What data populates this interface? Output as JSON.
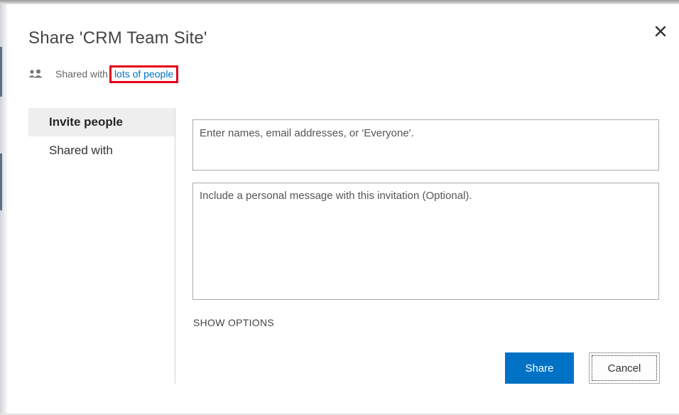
{
  "dialog": {
    "title": "Share 'CRM Team Site'",
    "close_icon": "close-icon",
    "shared_with_prefix": "Shared with",
    "shared_with_link": "lots of people",
    "people_icon": "people-icon"
  },
  "nav": {
    "items": [
      {
        "label": "Invite people",
        "selected": true
      },
      {
        "label": "Shared with",
        "selected": false
      }
    ]
  },
  "invite": {
    "names_placeholder": "Enter names, email addresses, or 'Everyone'.",
    "names_value": "",
    "message_placeholder": "Include a personal message with this invitation (Optional).",
    "message_value": "",
    "show_options_label": "SHOW OPTIONS"
  },
  "actions": {
    "share_label": "Share",
    "cancel_label": "Cancel"
  },
  "colors": {
    "accent": "#0072c6",
    "highlight_border": "#e3001b"
  }
}
